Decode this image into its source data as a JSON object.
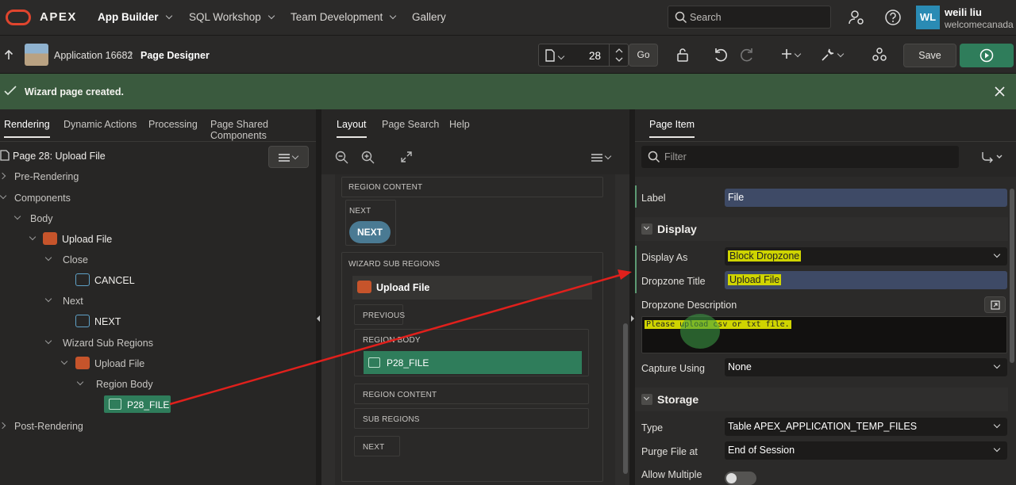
{
  "topbar": {
    "logo_text": "APEX",
    "nav": [
      {
        "label": "App Builder"
      },
      {
        "label": "SQL Workshop"
      },
      {
        "label": "Team Development"
      },
      {
        "label": "Gallery"
      }
    ],
    "search_placeholder": "Search",
    "user": {
      "initials": "WL",
      "name": "weili liu",
      "workspace": "welcomecanada"
    }
  },
  "toolbar": {
    "app_label": "Application 16682",
    "separator": "\\",
    "page_designer": "Page Designer",
    "page_number": "28",
    "go_label": "Go",
    "save_label": "Save"
  },
  "banner": {
    "message": "Wizard page created."
  },
  "left": {
    "tabs": [
      "Rendering",
      "Dynamic Actions",
      "Processing",
      "Page Shared Components"
    ],
    "page_title": "Page 28: Upload File",
    "tree": {
      "pre_rendering": "Pre-Rendering",
      "components": "Components",
      "body": "Body",
      "upload_file": "Upload File",
      "close": "Close",
      "cancel": "CANCEL",
      "next": "Next",
      "next_btn": "NEXT",
      "wizard_sub_regions": "Wizard Sub Regions",
      "upload_file_2": "Upload File",
      "region_body": "Region Body",
      "p28_file": "P28_FILE",
      "post_rendering": "Post-Rendering"
    }
  },
  "middle": {
    "tabs": [
      "Layout",
      "Page Search",
      "Help"
    ],
    "region_content_1": "REGION CONTENT",
    "next_label": "NEXT",
    "next_button": "NEXT",
    "wizard_sub_regions": "WIZARD SUB REGIONS",
    "upload_file": "Upload File",
    "previous": "PREVIOUS",
    "region_body": "REGION BODY",
    "p28_file": "P28_FILE",
    "region_content_2": "REGION CONTENT",
    "sub_regions": "SUB REGIONS",
    "next_bottom": "NEXT"
  },
  "right": {
    "tab": "Page Item",
    "filter_placeholder": "Filter",
    "label_label": "Label",
    "label_value": "File",
    "display_section": "Display",
    "display_as_label": "Display As",
    "display_as_value": "Block Dropzone",
    "dropzone_title_label": "Dropzone Title",
    "dropzone_title_value": "Upload File",
    "dropzone_desc_label": "Dropzone Description",
    "dropzone_desc_value": "Please upload csv or txt file.",
    "capture_label": "Capture Using",
    "capture_value": "None",
    "storage_section": "Storage",
    "type_label": "Type",
    "type_value": "Table APEX_APPLICATION_TEMP_FILES",
    "purge_label": "Purge File at",
    "purge_value": "End of Session",
    "allow_multiple_label": "Allow Multiple"
  },
  "colors": {
    "accent_green": "#2f7d5b",
    "banner": "#3a5a3e",
    "highlight": "#cfd400",
    "annotation_red": "#e0201c"
  }
}
